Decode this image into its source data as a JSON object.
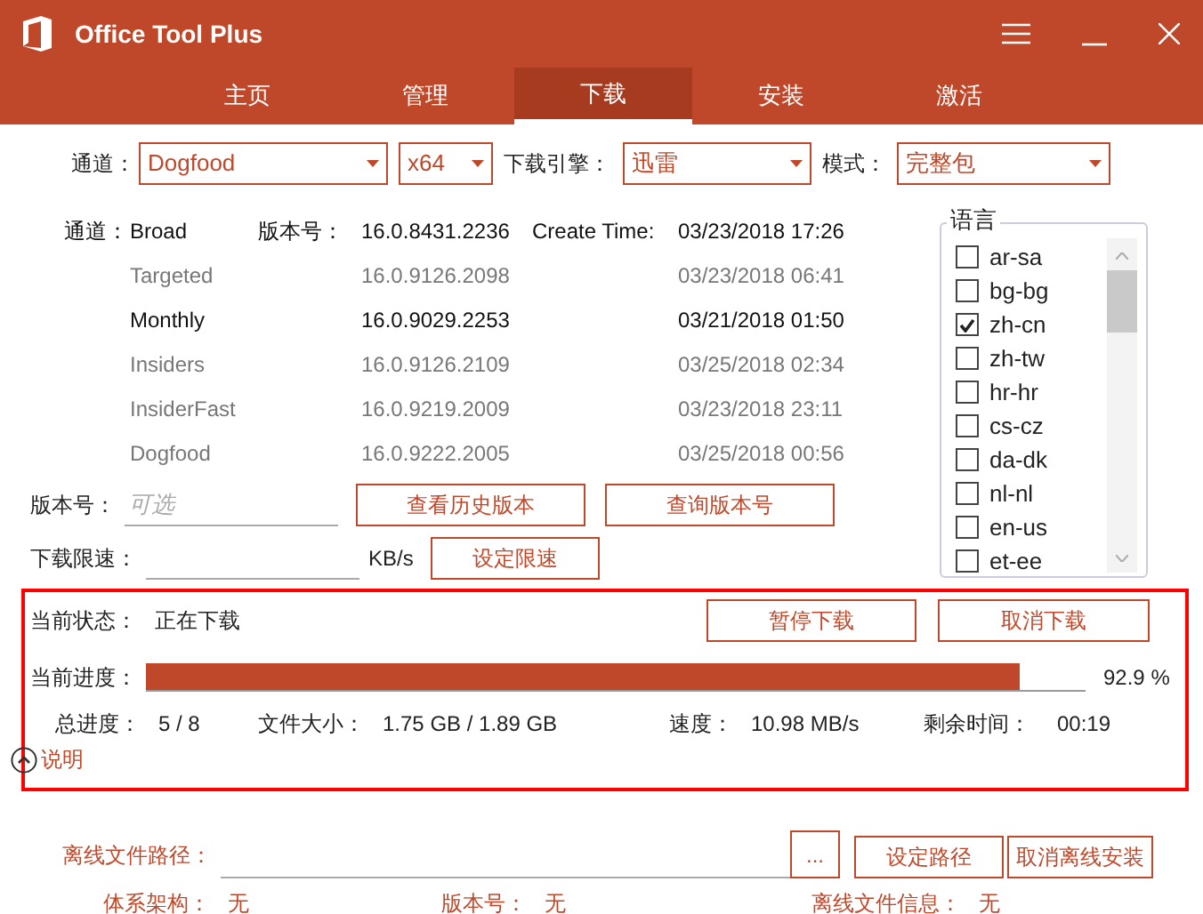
{
  "window": {
    "title": "Office Tool Plus"
  },
  "tabs": [
    {
      "label": "主页",
      "selected": false
    },
    {
      "label": "管理",
      "selected": false
    },
    {
      "label": "下载",
      "selected": true
    },
    {
      "label": "安装",
      "selected": false
    },
    {
      "label": "激活",
      "selected": false
    }
  ],
  "selectors": {
    "channel_label": "通道：",
    "channel": "Dogfood",
    "arch": "x64",
    "engine_label": "下载引擎：",
    "engine": "迅雷",
    "mode_label": "模式：",
    "mode": "完整包"
  },
  "channels": {
    "channel_label": "通道：",
    "version_label": "版本号：",
    "time_label": "Create Time:",
    "rows": [
      {
        "channel": "Broad",
        "version": "16.0.8431.2236",
        "time": "03/23/2018 17:26",
        "muted": false
      },
      {
        "channel": "Targeted",
        "version": "16.0.9126.2098",
        "time": "03/23/2018 06:41",
        "muted": true
      },
      {
        "channel": "Monthly",
        "version": "16.0.9029.2253",
        "time": "03/21/2018 01:50",
        "muted": false
      },
      {
        "channel": "Insiders",
        "version": "16.0.9126.2109",
        "time": "03/25/2018 02:34",
        "muted": true
      },
      {
        "channel": "InsiderFast",
        "version": "16.0.9219.2009",
        "time": "03/23/2018 23:11",
        "muted": true
      },
      {
        "channel": "Dogfood",
        "version": "16.0.9222.2005",
        "time": "03/25/2018 00:56",
        "muted": true
      }
    ]
  },
  "version": {
    "label": "版本号：",
    "placeholder": "可选",
    "buttons": [
      "查看历史版本",
      "查询版本号"
    ]
  },
  "speed_limit": {
    "label": "下载限速：",
    "unit": "KB/s",
    "button": "设定限速"
  },
  "languages": {
    "title": "语言",
    "items": [
      {
        "label": "ar-sa",
        "checked": false
      },
      {
        "label": "bg-bg",
        "checked": false
      },
      {
        "label": "zh-cn",
        "checked": true
      },
      {
        "label": "zh-tw",
        "checked": false
      },
      {
        "label": "hr-hr",
        "checked": false
      },
      {
        "label": "cs-cz",
        "checked": false
      },
      {
        "label": "da-dk",
        "checked": false
      },
      {
        "label": "nl-nl",
        "checked": false
      },
      {
        "label": "en-us",
        "checked": false
      },
      {
        "label": "et-ee",
        "checked": false
      }
    ]
  },
  "download": {
    "status_label": "当前状态：",
    "status": "正在下载",
    "buttons": [
      "暂停下载",
      "取消下载"
    ],
    "progress_label": "当前进度：",
    "progress": {
      "level": 0.929,
      "reading": "92.9 %"
    },
    "stats": [
      {
        "label": "总进度：",
        "value": "5 / 8"
      },
      {
        "label": "文件大小：",
        "value": "1.75 GB / 1.89 GB"
      },
      {
        "label": "速度：",
        "value": "10.98 MB/s"
      },
      {
        "label": "剩余时间：",
        "value": "00:19"
      }
    ],
    "help": "说明"
  },
  "offline": {
    "path_label": "离线文件路径：",
    "browse": "...",
    "buttons": [
      "设定路径",
      "取消离线安装"
    ],
    "info": [
      {
        "label": "体系架构：",
        "value": "无"
      },
      {
        "label": "版本号：",
        "value": "无"
      },
      {
        "label": "离线文件信息：",
        "value": "无"
      }
    ]
  }
}
